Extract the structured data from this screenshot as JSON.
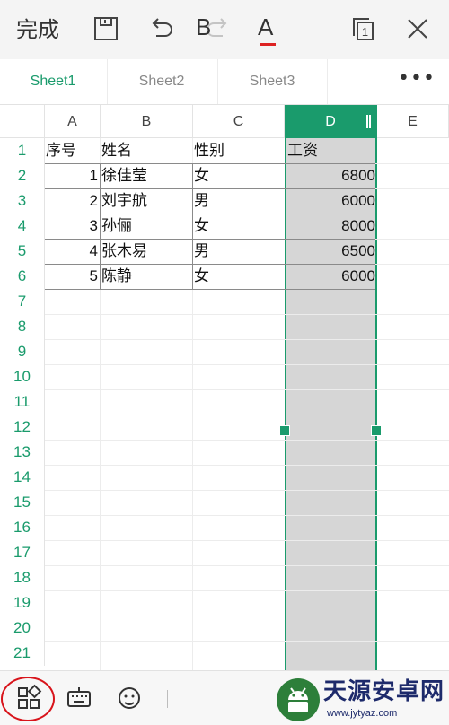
{
  "toolbar": {
    "done_label": "完成",
    "icons": [
      "save-icon",
      "undo-icon",
      "redo-icon",
      "window-count-icon",
      "close-icon"
    ],
    "window_count": "1"
  },
  "tabs": [
    {
      "label": "Sheet1",
      "active": true
    },
    {
      "label": "Sheet2",
      "active": false
    },
    {
      "label": "Sheet3",
      "active": false
    }
  ],
  "more_label": "•••",
  "grid": {
    "columns": [
      "A",
      "B",
      "C",
      "D",
      "E"
    ],
    "selected_column": "D",
    "rows": [
      "1",
      "2",
      "3",
      "4",
      "5",
      "6",
      "7",
      "8",
      "9",
      "10",
      "11",
      "12",
      "13",
      "14",
      "15",
      "16",
      "17",
      "18",
      "19",
      "20",
      "21"
    ],
    "headers": {
      "a": "序号",
      "b": "姓名",
      "c": "性别",
      "d": "工资"
    },
    "data": [
      {
        "no": "1",
        "name": "徐佳莹",
        "gender": "女",
        "salary": "6800"
      },
      {
        "no": "2",
        "name": "刘宇航",
        "gender": "男",
        "salary": "6000"
      },
      {
        "no": "3",
        "name": "孙俪",
        "gender": "女",
        "salary": "8000"
      },
      {
        "no": "4",
        "name": "张木易",
        "gender": "男",
        "salary": "6500"
      },
      {
        "no": "5",
        "name": "陈静",
        "gender": "女",
        "salary": "6000"
      }
    ]
  },
  "bottombar": {
    "icons": [
      "apps-grid-icon",
      "keyboard-icon",
      "face-icon"
    ],
    "bold_label": "B",
    "font_color_label": "A"
  },
  "watermark": {
    "name": "天源安卓网",
    "url": "www.jytyaz.com"
  },
  "colors": {
    "accent": "#1a9b6c",
    "selection_fill": "#d6d6d6",
    "annotation_circle": "#d8141b"
  }
}
